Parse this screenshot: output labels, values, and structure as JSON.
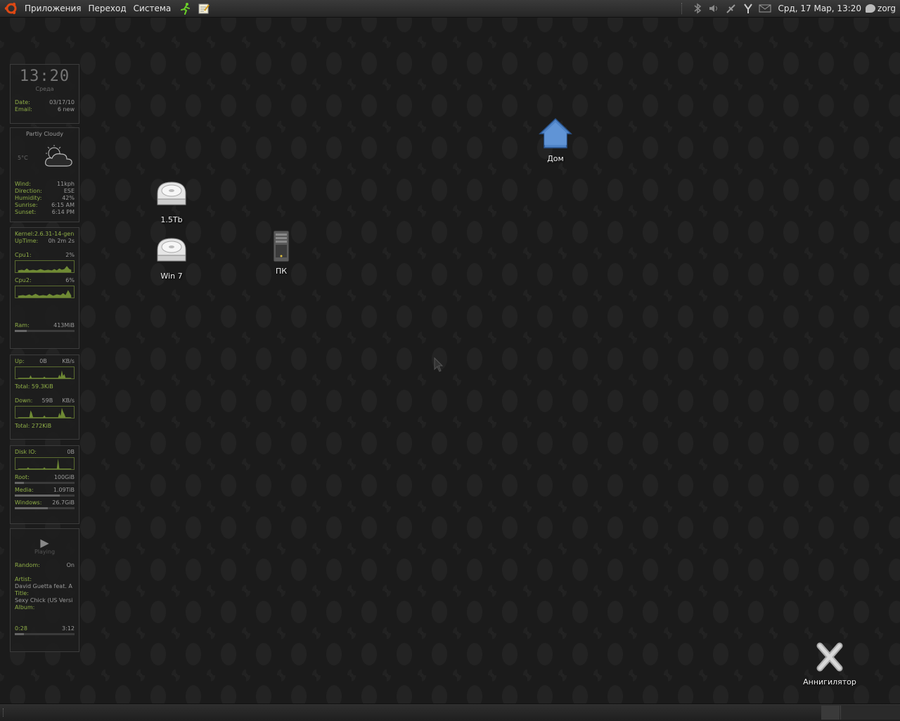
{
  "top_panel": {
    "menus": [
      "Приложения",
      "Переход",
      "Система"
    ],
    "clock": "Срд, 17 Мар, 13:20",
    "user": "zorg",
    "icons": [
      "ubuntu-logo-icon",
      "run-icon",
      "notes-icon",
      "bluetooth-icon",
      "volume-icon",
      "network-icon",
      "power-icon",
      "mail-icon",
      "chat-icon"
    ]
  },
  "widgets": {
    "clock": {
      "time": "13:20",
      "day": "Среда",
      "date_label": "Date:",
      "date": "03/17/10",
      "email_label": "Email:",
      "email": "6 new"
    },
    "weather": {
      "condition": "Partly Cloudy",
      "temp": "5°C",
      "rows": [
        {
          "k": "Wind:",
          "v": "11kph"
        },
        {
          "k": "Direction:",
          "v": "ESE"
        },
        {
          "k": "Humidity:",
          "v": "42%"
        },
        {
          "k": "Sunrise:",
          "v": "6:15 AM"
        },
        {
          "k": "Sunset:",
          "v": "6:14 PM"
        }
      ]
    },
    "system": {
      "kernel": "Kernel:2.6.31-14-gen",
      "uptime_label": "UpTime:",
      "uptime": "0h 2m 2s",
      "cpu1_label": "Cpu1:",
      "cpu1": "2%",
      "cpu2_label": "Cpu2:",
      "cpu2": "6%",
      "ram_label": "Ram:",
      "ram": "413MiB",
      "ram_fill": 0.2
    },
    "network": {
      "up_label": "Up:",
      "up": "0B",
      "up_unit": "KB/s",
      "up_total": "Total: 59.3KiB",
      "down_label": "Down:",
      "down": "59B",
      "down_unit": "KB/s",
      "down_total": "Total: 272KiB"
    },
    "disk": {
      "io_label": "Disk IO:",
      "io": "0B",
      "root_label": "Root:",
      "root": "100GiB",
      "root_fill": 0.15,
      "media_label": "Media:",
      "media": "1.09TiB",
      "media_fill": 0.75,
      "windows_label": "Windows:",
      "windows": "26.7GiB",
      "windows_fill": 0.55
    },
    "music": {
      "play_symbol": "▶",
      "status": "Playing",
      "random_label": "Random:",
      "random": "On",
      "artist_label": "Artist:",
      "artist": "David Guetta feat. A",
      "title_label": "Title:",
      "title": "Sexy Chick (US Versi",
      "album_label": "Album:",
      "elapsed": "0:28",
      "total": "3:12",
      "progress": 0.15
    }
  },
  "desktop_icons": {
    "home": "Дом",
    "disk1": "1.5Tb",
    "disk2": "Win 7",
    "pc": "ПК",
    "trash": "Аннигилятор"
  }
}
